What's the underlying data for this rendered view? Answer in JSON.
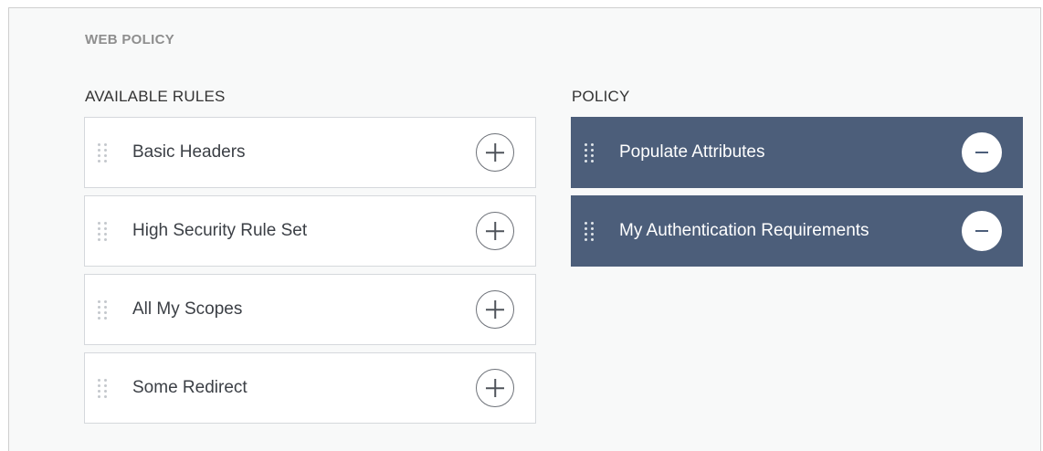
{
  "title": "WEB POLICY",
  "available": {
    "heading": "AVAILABLE RULES",
    "items": [
      {
        "label": "Basic Headers",
        "action_icon": "plus-circle-icon"
      },
      {
        "label": "High Security Rule Set",
        "action_icon": "plus-circle-icon"
      },
      {
        "label": "All My Scopes",
        "action_icon": "plus-circle-icon"
      },
      {
        "label": "Some Redirect",
        "action_icon": "plus-circle-icon"
      }
    ]
  },
  "policy": {
    "heading": "POLICY",
    "items": [
      {
        "label": "Populate Attributes",
        "action_icon": "minus-circle-icon"
      },
      {
        "label": "My Authentication Requirements",
        "action_icon": "minus-circle-icon"
      }
    ]
  },
  "colors": {
    "policy_item_bg": "#4c5e7a",
    "available_item_bg": "#ffffff",
    "panel_bg": "#f8f9f9"
  },
  "icons": {
    "drag_handle": "drag-handle-icon"
  }
}
